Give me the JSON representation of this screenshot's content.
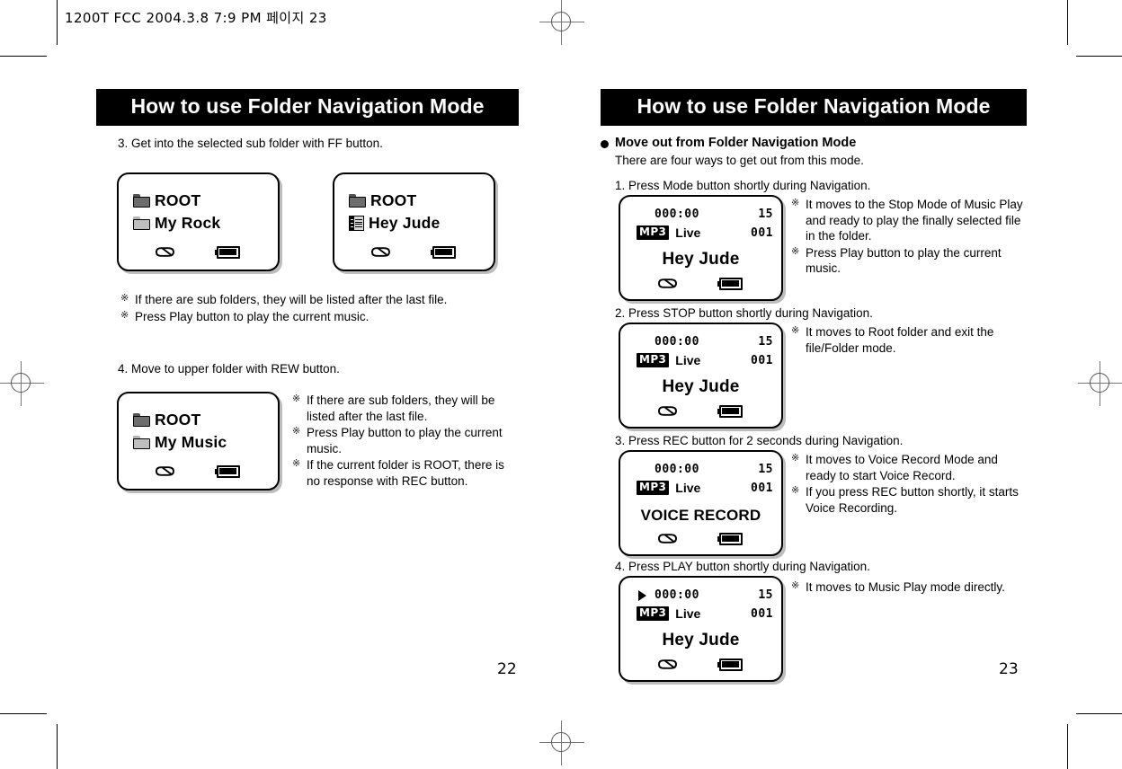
{
  "document": {
    "header_line": "1200T FCC  2004.3.8 7:9 PM  페이지 23",
    "left_page_number": "22",
    "right_page_number": "23"
  },
  "left_page": {
    "title": "How to use Folder Navigation Mode",
    "step3": {
      "text": "3. Get into the selected sub folder with FF button.",
      "screen_before": {
        "row1_label": "ROOT",
        "row1_icon": "folder-dark-icon",
        "row2_label": "My Rock",
        "row2_icon": "folder-light-icon",
        "repeat_icon": "repeat-icon",
        "battery_icon": "battery-icon"
      },
      "transition_icon": "arrow-right-icon",
      "screen_after": {
        "row1_label": "ROOT",
        "row1_icon": "folder-dark-icon",
        "row2_label": "Hey Jude",
        "row2_icon": "mp3-file-icon",
        "repeat_icon": "repeat-icon",
        "battery_icon": "battery-icon"
      },
      "notes": [
        "If there are sub folders, they will be listed after the last file.",
        "Press Play button to play the current music."
      ]
    },
    "step4": {
      "text": "4. Move to upper folder with REW button.",
      "screen": {
        "row1_label": "ROOT",
        "row1_icon": "folder-dark-icon",
        "row2_label": "My Music",
        "row2_icon": "folder-light-icon",
        "repeat_icon": "repeat-icon",
        "battery_icon": "battery-icon"
      },
      "notes": [
        "If there are sub folders, they will be listed after the last file.",
        "Press Play button to play the current music.",
        "If the current folder is ROOT, there is no response with REC button."
      ]
    }
  },
  "right_page": {
    "title": "How to use Folder Navigation Mode",
    "section_heading": "Move out from Folder Navigation Mode",
    "section_subtext": "There are four ways to get out from this mode.",
    "items": [
      {
        "step": "1. Press Mode button shortly during Navigation.",
        "screen": {
          "play_indicator": "",
          "time": "000:00",
          "total": "15",
          "format_badge": "MP3",
          "genre": "Live",
          "track_number": "001",
          "track_title": "Hey Jude",
          "repeat_icon": "repeat-icon",
          "battery_icon": "battery-icon"
        },
        "notes": [
          "It moves to the Stop Mode of Music Play and ready to play the finally selected file in the folder.",
          "Press Play button to play the current music."
        ]
      },
      {
        "step": "2. Press STOP button shortly during Navigation.",
        "screen": {
          "play_indicator": "",
          "time": "000:00",
          "total": "15",
          "format_badge": "MP3",
          "genre": "Live",
          "track_number": "001",
          "track_title": "Hey Jude",
          "repeat_icon": "repeat-icon",
          "battery_icon": "battery-icon"
        },
        "notes": [
          "It moves to Root folder and exit the file/Folder mode."
        ]
      },
      {
        "step": "3. Press REC button for 2 seconds during Navigation.",
        "screen": {
          "play_indicator": "",
          "time": "000:00",
          "total": "15",
          "format_badge": "MP3",
          "genre": "Live",
          "track_number": "001",
          "track_title": "VOICE RECORD",
          "repeat_icon": "repeat-icon",
          "battery_icon": "battery-icon"
        },
        "notes": [
          "It moves to Voice Record Mode and ready to start Voice Record.",
          "If you press REC button shortly, it starts Voice Recording."
        ]
      },
      {
        "step": "4. Press PLAY button shortly during Navigation.",
        "screen": {
          "play_indicator": "play-triangle-icon",
          "time": "000:00",
          "total": "15",
          "format_badge": "MP3",
          "genre": "Live",
          "track_number": "001",
          "track_title": "Hey Jude",
          "repeat_icon": "repeat-icon",
          "battery_icon": "battery-icon"
        },
        "notes": [
          "It moves to Music Play mode directly."
        ]
      }
    ]
  },
  "marks": {
    "note_marker": "※"
  }
}
